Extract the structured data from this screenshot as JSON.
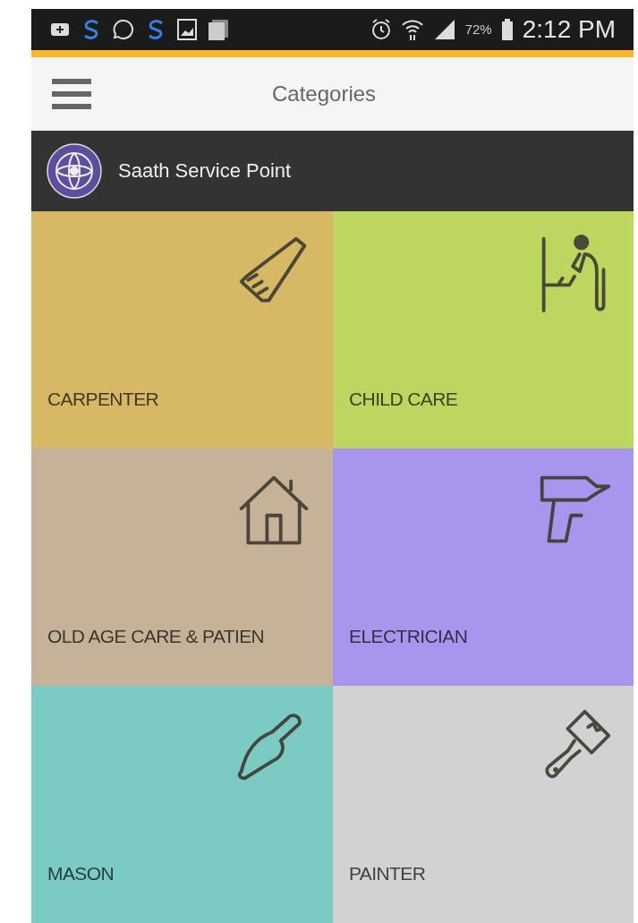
{
  "status_bar": {
    "battery": "72%",
    "time": "2:12 PM"
  },
  "toolbar": {
    "title": "Categories"
  },
  "header": {
    "title": "Saath Service Point"
  },
  "tiles": [
    {
      "label": "CARPENTER",
      "kind": "saw",
      "color": "#d6b865"
    },
    {
      "label": "CHILD CARE",
      "kind": "childcare",
      "color": "#bcd65f"
    },
    {
      "label": "OLD AGE CARE & PATIEN",
      "kind": "house",
      "color": "#c6b299"
    },
    {
      "label": "ELECTRICIAN",
      "kind": "drill",
      "color": "#a896ee"
    },
    {
      "label": "MASON",
      "kind": "trowel",
      "color": "#7bcbc4"
    },
    {
      "label": "PAINTER",
      "kind": "brush",
      "color": "#d0d3d2"
    }
  ]
}
